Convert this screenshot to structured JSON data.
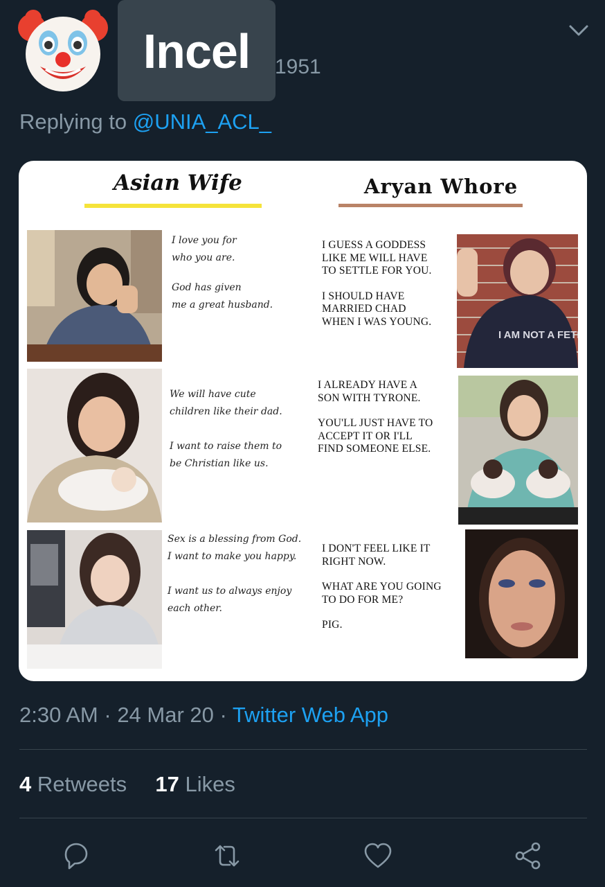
{
  "header": {
    "avatar_icon": "clown-face-icon",
    "display_name": "Incel",
    "handle_fragment": "1951",
    "menu_icon": "chevron-down-icon"
  },
  "reply": {
    "prefix": "Replying to",
    "mention": "@UNIA_ACL_"
  },
  "media": {
    "left_title": "Asian Wife",
    "right_title": "Aryan Whore",
    "left_underline_color": "#f5e33a",
    "right_underline_color": "#b98367",
    "rows": [
      {
        "wife_lines": [
          "I love you for",
          "who you are."
        ],
        "wife_lines2": [
          "God has given",
          "me a great husband."
        ],
        "whore_lines": [
          "I GUESS A GODDESS",
          "LIKE ME WILL HAVE",
          "TO SETTLE FOR YOU."
        ],
        "whore_lines2": [
          "I SHOULD HAVE",
          "MARRIED CHAD",
          "WHEN I WAS YOUNG."
        ],
        "whore_shirt_text": "I AM NOT A FETISH"
      },
      {
        "wife_lines": [
          "We will have cute",
          "children like their dad."
        ],
        "wife_lines2": [
          "I want to raise them to",
          "be Christian like us."
        ],
        "whore_lines": [
          "I ALREADY HAVE A",
          "SON WITH TYRONE."
        ],
        "whore_lines2": [
          "YOU'LL JUST HAVE TO",
          "ACCEPT IT OR I'LL",
          "FIND SOMEONE ELSE."
        ]
      },
      {
        "wife_lines": [
          "Sex is a blessing from God.",
          "I want to make you happy."
        ],
        "wife_lines2": [
          "I want us to always enjoy",
          "each other."
        ],
        "whore_lines": [
          "I DON'T FEEL LIKE IT",
          "RIGHT NOW."
        ],
        "whore_lines2": [
          "WHAT ARE YOU GOING",
          "TO DO FOR ME?"
        ],
        "whore_lines3": [
          "PIG."
        ]
      }
    ]
  },
  "footer": {
    "time": "2:30 AM",
    "date": "24 Mar 20",
    "app": "Twitter Web App",
    "retweets_count": "4",
    "retweets_label": "Retweets",
    "likes_count": "17",
    "likes_label": "Likes"
  },
  "actions": [
    {
      "icon": "reply-icon"
    },
    {
      "icon": "retweet-icon"
    },
    {
      "icon": "like-heart-icon"
    },
    {
      "icon": "share-icon"
    }
  ],
  "colors": {
    "background": "#15202b",
    "link": "#1da1f2",
    "secondary_text": "#8899a6"
  }
}
